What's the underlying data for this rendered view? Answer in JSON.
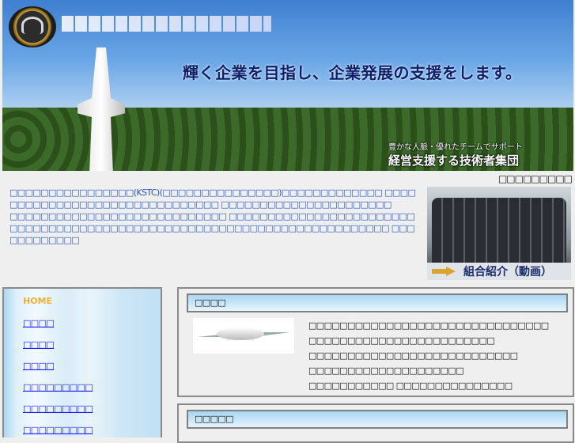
{
  "banner": {
    "logo_lettering": "近畿産業技術クラスター協同組合",
    "slogan_lettering": "輝く企業を目指し、企業発展の支援をします。",
    "tagline_lettering": "豊かな人脈・優れたチームでサポート",
    "tagline2_lettering": "経営支援する技術者集団"
  },
  "top_right_text": "□□□□□□□□□",
  "intro": {
    "p1": "□□□□□□□□□□□□□□□□(KSTC)(□□□□□□□□□□□□□□□)□□□□□□□□□□□□□ □□□□□□□□□□□□□□□□□□□□□□□□□□□□□□□ □□□□□□□□□□□□□□□□□□□□□□",
    "p2": "□□□□□□□□□□□□□□□□□□□□□□□□□□□□ □□□□□□□□□□□□□□□□□□□□□□□□□□□□□□□□□□□□□□□□□□□□□□□□□□□□□□□□□□□□□□□□□□□□□□□□□ □□□□□□□□□□□□"
  },
  "photo_caption_lettering": "組合紹介（動画）",
  "sidebar": {
    "items": [
      {
        "label": "HOME"
      },
      {
        "label": "□□□□"
      },
      {
        "label": "□□□□"
      },
      {
        "label": "□□□□"
      },
      {
        "label": "□□□□□□□□□"
      },
      {
        "label": "□□□□□□□□□"
      },
      {
        "label": "□□□□□□□□□"
      }
    ]
  },
  "panels": [
    {
      "heading": "□□□□",
      "lines": [
        "□□□□□□□□□□□□□□□□□□□□□□□□□□□□□□□",
        "□□□□□□□□□□□□□□□□□□□□□□□□",
        "□□□□□□□□□□□□□□□□□□□□□□□□□□□",
        "□□□□□□□□□□□□□□□□□□□□",
        "□□□□□□□□□□□ □□□□□□□□□□□□□□□"
      ]
    },
    {
      "heading": "□□□□□"
    }
  ]
}
